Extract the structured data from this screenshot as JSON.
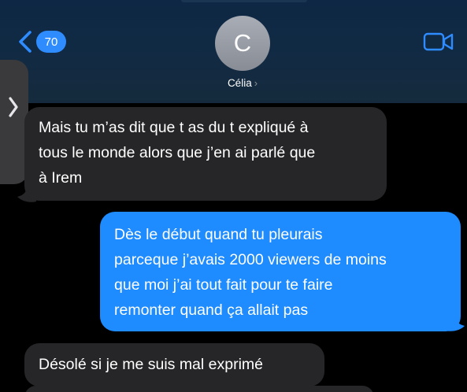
{
  "header": {
    "back_badge_count": "70",
    "avatar_initial": "C",
    "contact_name": "Célia",
    "contact_chevron": "›",
    "icons": {
      "back": "chevron-left-icon",
      "video": "video-camera-icon",
      "side": "chevron-right-icon"
    }
  },
  "colors": {
    "accent": "#2f8cff",
    "sent_bubble": "#1e8bfe",
    "received_bubble": "#262628",
    "background": "#000000"
  },
  "messages": [
    {
      "direction": "received",
      "text": "Mais tu m’as dit que t as du t expliqué à\ntous le monde alors que j’en ai parlé que\nà Irem"
    },
    {
      "direction": "sent",
      "text": "Dès le début quand tu pleurais\nparceque j’avais 2000 viewers de moins\nque moi j’ai tout fait pour te faire\nremonter quand ça allait pas"
    },
    {
      "direction": "received",
      "text": "Désolé si je me suis mal exprimé"
    }
  ]
}
